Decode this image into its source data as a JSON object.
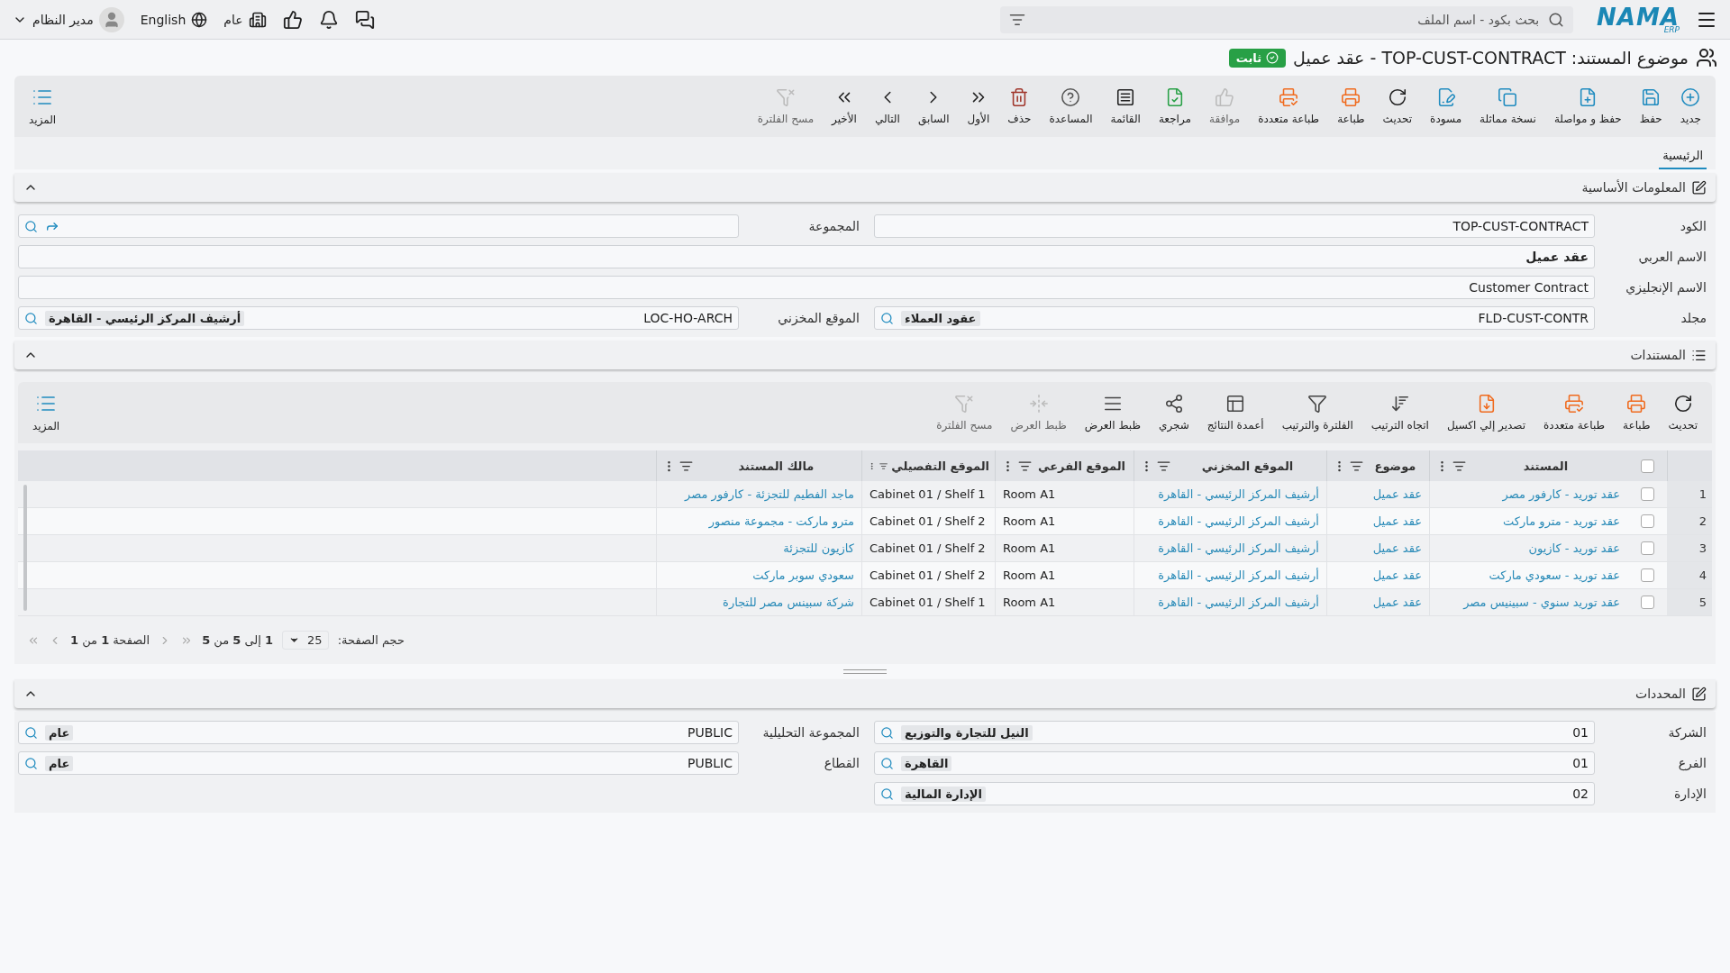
{
  "top_bar": {
    "logo": "NAMA",
    "logo_sub": "ERP",
    "search": {
      "placeholder": "بحث بكود - اسم الملف"
    },
    "company": "عام",
    "language": "English",
    "user": "مدير النظام"
  },
  "title": {
    "text": "موضوع المستند: TOP-CUST-CONTRACT - عقد عميل",
    "status": "ثابت"
  },
  "toolbar": {
    "items": [
      {
        "label": "جديد",
        "disabled": false
      },
      {
        "label": "حفظ",
        "disabled": false
      },
      {
        "label": "حفظ و مواصلة",
        "disabled": false
      },
      {
        "label": "نسخة مماثلة",
        "disabled": false
      },
      {
        "label": "مسودة",
        "disabled": false
      },
      {
        "label": "تحديث",
        "disabled": false
      },
      {
        "label": "طباعة",
        "disabled": false
      },
      {
        "label": "طباعة متعددة",
        "disabled": false
      },
      {
        "label": "موافقة",
        "disabled": true
      },
      {
        "label": "مراجعة",
        "disabled": false
      },
      {
        "label": "القائمة",
        "disabled": false
      },
      {
        "label": "المساعدة",
        "disabled": false
      },
      {
        "label": "حذف",
        "disabled": false
      },
      {
        "label": "الأول",
        "disabled": false
      },
      {
        "label": "السابق",
        "disabled": false
      },
      {
        "label": "التالي",
        "disabled": false
      },
      {
        "label": "الأخير",
        "disabled": false
      },
      {
        "label": "مسح الفلترة",
        "disabled": true
      }
    ],
    "more": "المزيد"
  },
  "tabs": [
    {
      "label": "الرئيسية",
      "selected": true
    }
  ],
  "basic_info": {
    "title": "المعلومات الأساسية",
    "expanded": true,
    "rows": [
      {
        "wide": false,
        "fields": [
          {
            "label": "الكود",
            "kind": "text",
            "value": "TOP-CUST-CONTRACT",
            "bold": false
          },
          {
            "label": "المجموعة",
            "kind": "picker"
          }
        ]
      },
      {
        "wide": true,
        "fields": [
          {
            "label": "الاسم العربي",
            "kind": "text",
            "value": "عقد عميل",
            "bold": true
          }
        ]
      },
      {
        "wide": true,
        "fields": [
          {
            "label": "الاسم الإنجليزي",
            "kind": "text",
            "value": "Customer Contract",
            "bold": false
          }
        ]
      },
      {
        "wide": false,
        "fields": [
          {
            "label": "مجلد",
            "kind": "lookup",
            "code": "FLD-CUST-CONTR",
            "name": "عقود العملاء"
          },
          {
            "label": "الموقع المخزني",
            "kind": "lookup",
            "code": "LOC-HO-ARCH",
            "name": "أرشيف المركز الرئيسي - القاهرة"
          }
        ]
      }
    ]
  },
  "documents": {
    "title": "المستندات",
    "expanded": true,
    "toolbar": {
      "items": [
        {
          "label": "تحديث",
          "disabled": false
        },
        {
          "label": "طباعة",
          "disabled": false
        },
        {
          "label": "طباعة متعددة",
          "disabled": false
        },
        {
          "label": "تصدير إلي اكسيل",
          "disabled": false
        },
        {
          "label": "اتجاه الترتيب",
          "disabled": false
        },
        {
          "label": "الفلترة والترتيب",
          "disabled": false
        },
        {
          "label": "أعمدة النتائج",
          "disabled": false
        },
        {
          "label": "شجري",
          "disabled": false
        },
        {
          "label": "ظبط العرض",
          "disabled": false
        },
        {
          "label": "ظبط العرض",
          "disabled": true
        },
        {
          "label": "مسح الفلترة",
          "disabled": true
        }
      ],
      "more": "المزيد"
    },
    "table": {
      "all_checked": false,
      "columns": [
        {
          "label": "المستند",
          "kind": "link"
        },
        {
          "label": "موضوع",
          "kind": "link"
        },
        {
          "label": "الموقع المخزني",
          "kind": "link"
        },
        {
          "label": "الموقع الفرعي",
          "kind": "text"
        },
        {
          "label": "الموقع التفصيلي",
          "kind": "text"
        },
        {
          "label": "مالك المستند",
          "kind": "link"
        }
      ],
      "rows": [
        {
          "number": "1",
          "checked": false,
          "cells": [
            "عقد توريد - كارفور مصر",
            "عقد عميل",
            "أرشيف المركز الرئيسي - القاهرة",
            "Room A1",
            "Cabinet 01 / Shelf 1",
            "ماجد الفطيم للتجزئة - كارفور مصر"
          ]
        },
        {
          "number": "2",
          "checked": false,
          "cells": [
            "عقد توريد - مترو ماركت",
            "عقد عميل",
            "أرشيف المركز الرئيسي - القاهرة",
            "Room A1",
            "Cabinet 01 / Shelf 2",
            "مترو ماركت - مجموعة منصور"
          ]
        },
        {
          "number": "3",
          "checked": false,
          "cells": [
            "عقد توريد - كازيون",
            "عقد عميل",
            "أرشيف المركز الرئيسي - القاهرة",
            "Room A1",
            "Cabinet 01 / Shelf 2",
            "كازيون للتجزئة"
          ]
        },
        {
          "number": "4",
          "checked": false,
          "cells": [
            "عقد توريد - سعودي ماركت",
            "عقد عميل",
            "أرشيف المركز الرئيسي - القاهرة",
            "Room A1",
            "Cabinet 01 / Shelf 2",
            "سعودي سوبر ماركت"
          ]
        },
        {
          "number": "5",
          "checked": false,
          "cells": [
            "عقد توريد سنوي - سبينيس مصر",
            "عقد عميل",
            "أرشيف المركز الرئيسي - القاهرة",
            "Room A1",
            "Cabinet 01 / Shelf 1",
            "شركة سبينس مصر للتجارة"
          ]
        }
      ]
    },
    "pager": {
      "page_size_label": "حجم الصفحة:",
      "page_size": "25",
      "range": "**1** إلى **5** من **5**",
      "page": "الصفحة **1** من **1**"
    }
  },
  "determinants": {
    "title": "المحددات",
    "expanded": true,
    "rows": [
      {
        "wide": false,
        "fields": [
          {
            "label": "الشركة",
            "kind": "lookup",
            "code": "01",
            "name": "النيل للتجارة والتوزيع"
          },
          {
            "label": "المجموعة التحليلية",
            "kind": "lookup",
            "code": "PUBLIC",
            "name": "عام"
          }
        ]
      },
      {
        "wide": false,
        "fields": [
          {
            "label": "الفرع",
            "kind": "lookup",
            "code": "01",
            "name": "القاهرة"
          },
          {
            "label": "القطاع",
            "kind": "lookup",
            "code": "PUBLIC",
            "name": "عام"
          }
        ]
      },
      {
        "wide": false,
        "fields": [
          {
            "label": "الإدارة",
            "kind": "lookup",
            "code": "02",
            "name": "الإدارة المالية"
          }
        ]
      }
    ]
  }
}
